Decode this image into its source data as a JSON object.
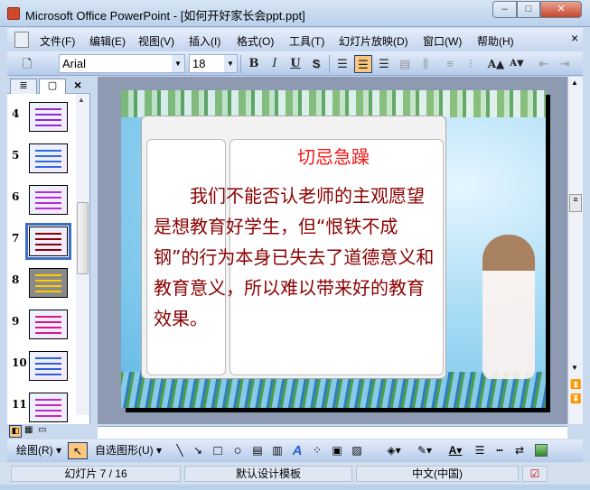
{
  "window": {
    "title": "Microsoft Office PowerPoint - [如何开好家长会ppt.ppt]",
    "minimize": "‒",
    "maximize": "□",
    "close": "✕"
  },
  "menu": {
    "items": [
      "文件(F)",
      "编辑(E)",
      "视图(V)",
      "插入(I)",
      "格式(O)",
      "工具(T)",
      "幻灯片放映(D)",
      "窗口(W)",
      "帮助(H)"
    ],
    "close": "×"
  },
  "formatting": {
    "font": "Arial",
    "size": "18",
    "bold": "B",
    "italic": "I",
    "underline": "U",
    "shadow": "S",
    "increase_font": "A▲",
    "decrease_font": "A▼"
  },
  "panel": {
    "slide_numbers": [
      "4",
      "5",
      "6",
      "7",
      "8",
      "9",
      "10",
      "11"
    ],
    "selected": "7",
    "close": "×"
  },
  "slide": {
    "title": "切忌急躁",
    "body": "我们不能否认老师的主观愿望是想教育好学生，但“恨铁不成钢”的行为本身已失去了道德意义和教育意义，所以难以带来好的教育效果。",
    "title_color": "#f01818",
    "body_color": "#8b0000"
  },
  "drawing": {
    "draw_menu": "绘图(R)",
    "autoshapes": "自选图形(U)"
  },
  "status": {
    "slide": "幻灯片 7 / 16",
    "template": "默认设计模板",
    "language": "中文(中国)"
  }
}
